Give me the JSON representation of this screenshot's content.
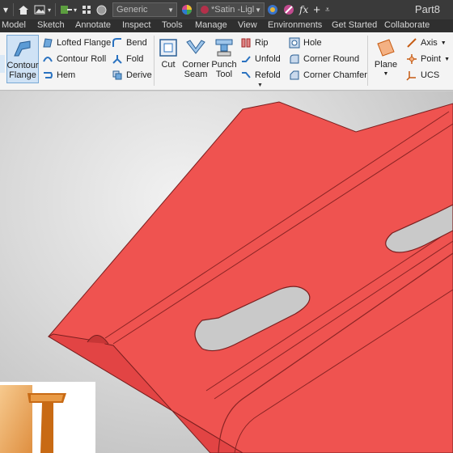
{
  "app": {
    "document_title": "Part8",
    "accent": "#ef5350"
  },
  "quick_access": {
    "material_value": "Generic",
    "appearance_value": "*Satin -Ligl",
    "fx_symbol": "fx"
  },
  "tabs": [
    "Model",
    "Sketch",
    "Annotate",
    "Inspect",
    "Tools",
    "Manage",
    "View",
    "Environments",
    "Get Started",
    "Collaborate"
  ],
  "ribbon": {
    "contour_flange": [
      "Contour",
      "Flange"
    ],
    "small_col1": [
      "Lofted Flange",
      "Contour Roll",
      "Hem"
    ],
    "small_col2": [
      "Bend",
      "Fold",
      "Derive"
    ],
    "cut": "Cut",
    "corner_seam": [
      "Corner",
      "Seam"
    ],
    "punch_tool": [
      "Punch",
      "Tool"
    ],
    "small_col3": [
      "Rip",
      "Unfold",
      "Refold"
    ],
    "small_col4": [
      "Hole",
      "Corner Round",
      "Corner Chamfer"
    ],
    "plane": "Plane",
    "small_col5": [
      "Axis",
      "Point",
      "UCS"
    ]
  }
}
